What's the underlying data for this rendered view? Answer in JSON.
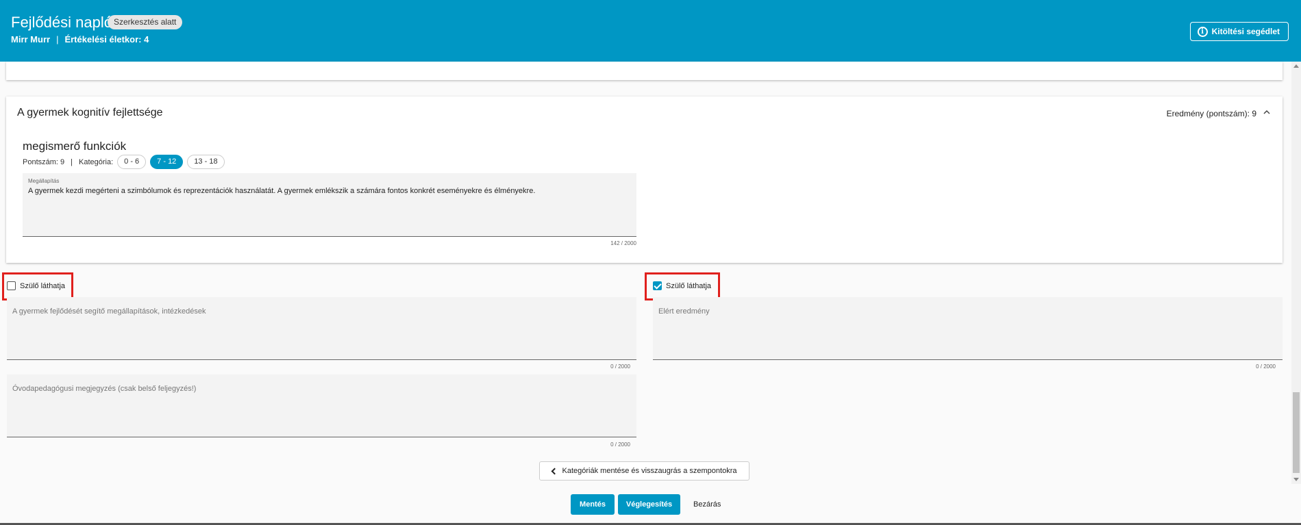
{
  "header": {
    "title": "Fejlődési napló",
    "badge": "Szerkesztés alatt",
    "child_name": "Mirr Murr",
    "separator": "|",
    "age_label": "Értékelési életkor: 4",
    "help_label": "Kitöltési segédlet",
    "help_icon": "info-icon",
    "bg_color": "#0097c4"
  },
  "section": {
    "title": "A gyermek kognitív fejlettsége",
    "result": "Eredmény (pontszám): 9",
    "collapse_icon": "chevron-up-icon",
    "item": {
      "title": "megismerő funkciók",
      "score_label": "Pontszám: 9",
      "separator": "|",
      "category_label": "Kategória:",
      "categories": [
        {
          "label": "0 - 6",
          "active": false
        },
        {
          "label": "7 - 12",
          "active": true
        },
        {
          "label": "13 - 18",
          "active": false
        }
      ],
      "finding": {
        "label": "Megállapítás",
        "value": "A gyermek kezdi megérteni a szimbólumok és reprezentációk használatát. A gyermek emlékszik a számára fontos konkrét eseményekre és élményekre.",
        "counter": "142 / 2000"
      }
    }
  },
  "left_block": {
    "checkbox_label": "Szülő láthatja",
    "checked": false,
    "field1": {
      "placeholder": "A gyermek fejlődését segítő megállapítások, intézkedések",
      "counter": "0 / 2000"
    },
    "field2": {
      "placeholder": "Óvodapedagógusi megjegyzés (csak belső feljegyzés!)",
      "counter": "0 / 2000"
    }
  },
  "right_block": {
    "checkbox_label": "Szülő láthatja",
    "checked": true,
    "field1": {
      "placeholder": "Elért eredmény",
      "counter": "0 / 2000"
    }
  },
  "actions": {
    "back_label": "Kategóriák mentése és visszaugrás a szempontokra",
    "save_label": "Mentés",
    "finalize_label": "Véglegesítés",
    "close_label": "Bezárás"
  }
}
